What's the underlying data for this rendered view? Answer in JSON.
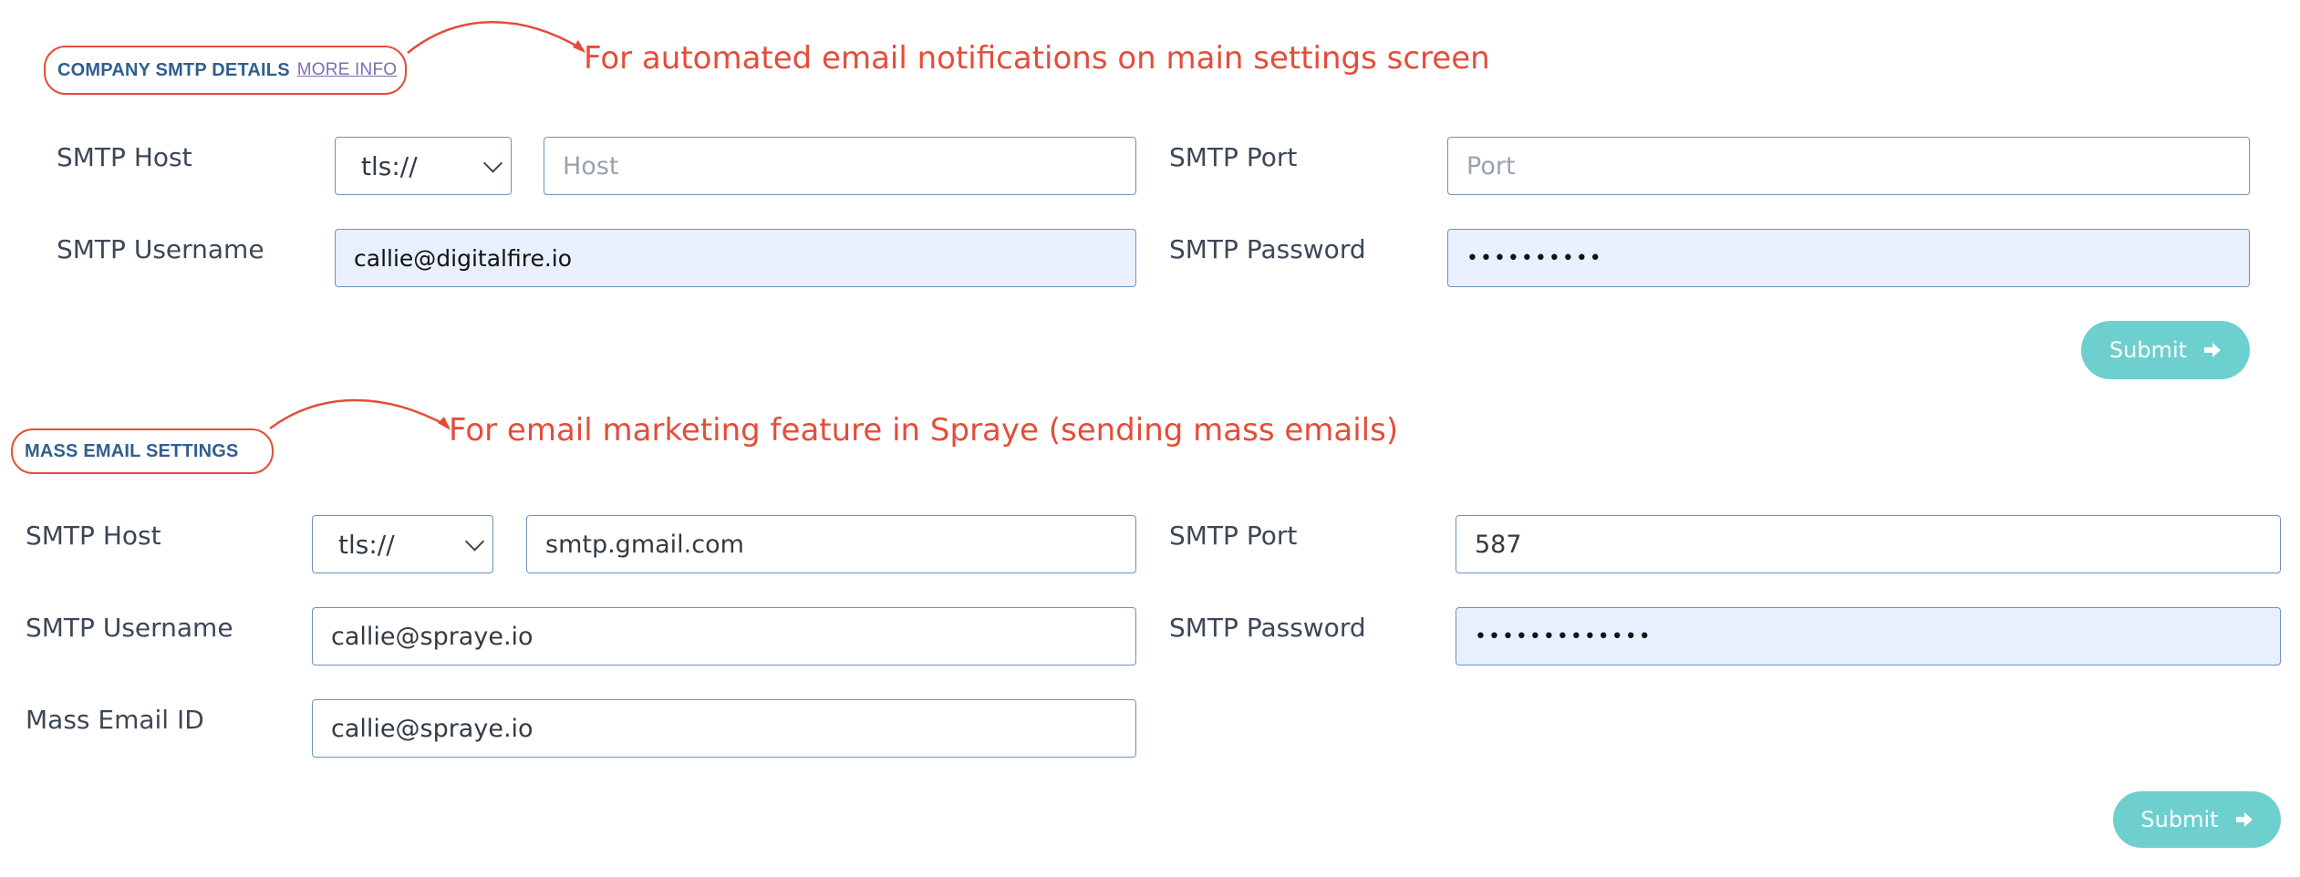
{
  "company": {
    "title": "COMPANY SMTP DETAILS",
    "more_info": "MORE INFO",
    "annotation": "For automated email notifications on main settings screen",
    "host_label": "SMTP Host",
    "protocol": "tls://",
    "host_placeholder": "Host",
    "host_value": "",
    "port_label": "SMTP Port",
    "port_placeholder": "Port",
    "port_value": "",
    "username_label": "SMTP Username",
    "username_value": "callie@digitalfire.io",
    "password_label": "SMTP Password",
    "password_value": "••••••••••",
    "submit_label": "Submit"
  },
  "mass": {
    "title": "MASS EMAIL SETTINGS",
    "annotation": "For email marketing feature in Spraye (sending mass emails)",
    "host_label": "SMTP Host",
    "protocol": "tls://",
    "host_value": "smtp.gmail.com",
    "port_label": "SMTP Port",
    "port_value": "587",
    "username_label": "SMTP Username",
    "username_value": "callie@spraye.io",
    "password_label": "SMTP Password",
    "password_value": "•••••••••••••",
    "mass_email_label": "Mass Email ID",
    "mass_email_value": "callie@spraye.io",
    "submit_label": "Submit"
  },
  "colors": {
    "annotation": "#e44d3a",
    "title": "#2f5f8f",
    "button": "#6ecfcf",
    "input_border": "#6e93b8",
    "autofill": "#e8f0fe"
  },
  "icons": {
    "submit": "arrow-right-icon",
    "select": "chevron-down-icon"
  }
}
